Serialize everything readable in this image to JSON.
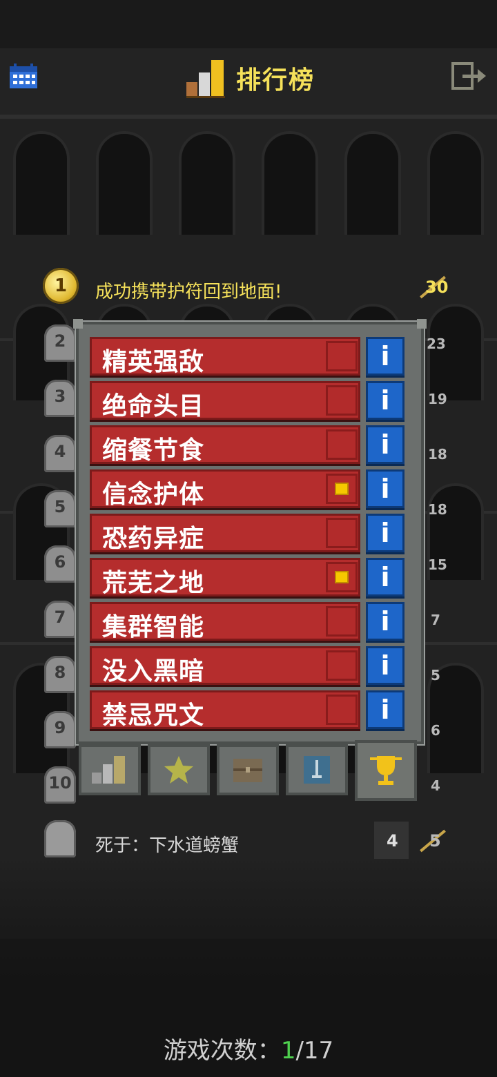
{
  "header": {
    "title": "排行榜"
  },
  "top_record": {
    "rank": "1",
    "description": "成功携带护符回到地面!",
    "score": "30"
  },
  "tombstone_ranks": [
    "2",
    "3",
    "4",
    "5",
    "6",
    "7",
    "8",
    "9",
    "10"
  ],
  "side_scores": [
    "23",
    "19",
    "18",
    "18",
    "15",
    "7",
    "5",
    "6",
    "4"
  ],
  "last_record": {
    "description": "死于：下水道螃蟹",
    "depth": "4",
    "score": "5"
  },
  "challenges": [
    {
      "label": "精英强敌",
      "checked": false
    },
    {
      "label": "绝命头目",
      "checked": false
    },
    {
      "label": "缩餐节食",
      "checked": false
    },
    {
      "label": "信念护体",
      "checked": true
    },
    {
      "label": "恐药异症",
      "checked": false
    },
    {
      "label": "荒芜之地",
      "checked": true
    },
    {
      "label": "集群智能",
      "checked": false
    },
    {
      "label": "没入黑暗",
      "checked": false
    },
    {
      "label": "禁忌咒文",
      "checked": false
    }
  ],
  "info_glyph": "i",
  "tabs": [
    {
      "icon": "bar-chart-icon",
      "active": false
    },
    {
      "icon": "star-icon",
      "active": false
    },
    {
      "icon": "chest-icon",
      "active": false
    },
    {
      "icon": "sword-badge-icon",
      "active": false
    },
    {
      "icon": "trophy-icon",
      "active": true
    }
  ],
  "footer": {
    "label": "游戏次数：",
    "current": "1",
    "total": "/17"
  },
  "colors": {
    "gold": "#f5e15a",
    "challenge_red": "#b52d2d",
    "info_blue": "#1e66c9",
    "checked_yellow": "#f6c800"
  }
}
